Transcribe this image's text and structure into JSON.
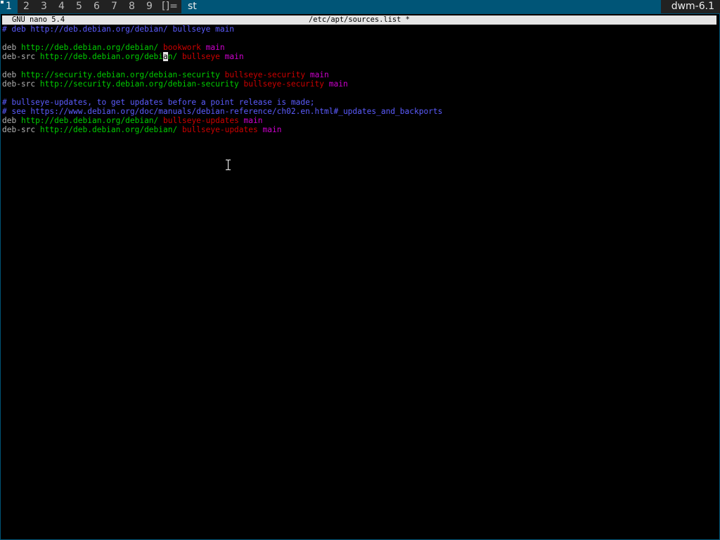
{
  "dwm": {
    "tags": [
      "1",
      "2",
      "3",
      "4",
      "5",
      "6",
      "7",
      "8",
      "9"
    ],
    "selected_tag": "1",
    "layout_symbol": "[]=",
    "window_title": "st",
    "status": "dwm-6.1"
  },
  "nano": {
    "version": "GNU nano 5.4",
    "filename": "/etc/apt/sources.list *"
  },
  "buffer": {
    "lines": [
      [
        {
          "t": "# deb http://deb.debian.org/debian/ bullseye main",
          "c": "comment"
        }
      ],
      [],
      [
        {
          "t": "deb ",
          "c": "kw"
        },
        {
          "t": "http://deb.debian.org/debian/ ",
          "c": "url"
        },
        {
          "t": "bookwork ",
          "c": "dist"
        },
        {
          "t": "main",
          "c": "comp"
        }
      ],
      [
        {
          "t": "deb-src ",
          "c": "kw"
        },
        {
          "t": "http://deb.debian.org/debi",
          "c": "url"
        },
        {
          "t": "a",
          "c": "cursor"
        },
        {
          "t": "n/ ",
          "c": "url"
        },
        {
          "t": "bullseye ",
          "c": "dist"
        },
        {
          "t": "main",
          "c": "comp"
        }
      ],
      [],
      [
        {
          "t": "deb ",
          "c": "kw"
        },
        {
          "t": "http://security.debian.org/debian-security ",
          "c": "url"
        },
        {
          "t": "bullseye-security ",
          "c": "dist"
        },
        {
          "t": "main",
          "c": "comp"
        }
      ],
      [
        {
          "t": "deb-src ",
          "c": "kw"
        },
        {
          "t": "http://security.debian.org/debian-security ",
          "c": "url"
        },
        {
          "t": "bullseye-security ",
          "c": "dist"
        },
        {
          "t": "main",
          "c": "comp"
        }
      ],
      [],
      [
        {
          "t": "# bullseye-updates, to get updates before a point release is made;",
          "c": "comment"
        }
      ],
      [
        {
          "t": "# see https://www.debian.org/doc/manuals/debian-reference/ch02.en.html#_updates_and_backports",
          "c": "comment"
        }
      ],
      [
        {
          "t": "deb ",
          "c": "kw"
        },
        {
          "t": "http://deb.debian.org/debian/ ",
          "c": "url"
        },
        {
          "t": "bullseye-updates ",
          "c": "dist"
        },
        {
          "t": "main",
          "c": "comp"
        }
      ],
      [
        {
          "t": "deb-src ",
          "c": "kw"
        },
        {
          "t": "http://deb.debian.org/debian/ ",
          "c": "url"
        },
        {
          "t": "bullseye-updates ",
          "c": "dist"
        },
        {
          "t": "main",
          "c": "comp"
        }
      ]
    ]
  },
  "icons": {
    "pointer": "ibeam-cursor-icon",
    "tag_indicator": "occupied-tag-indicator-icon"
  },
  "colors": {
    "dwm_selected": "#005577",
    "dwm_bar": "#222222",
    "comment": "#5c5cff",
    "keyword": "#b2b2b2",
    "url": "#00cd00",
    "distribution": "#cd0000",
    "component": "#cd00cd"
  }
}
